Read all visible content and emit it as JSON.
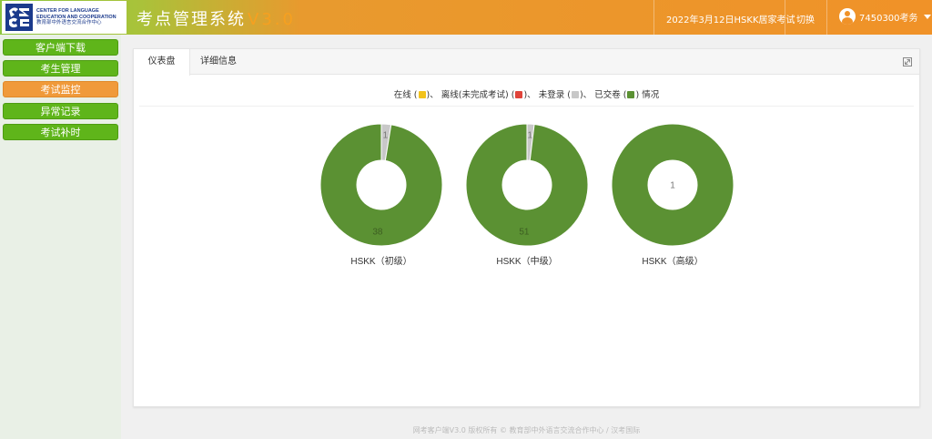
{
  "header": {
    "logo_en_line1": "CENTER FOR LANGUAGE",
    "logo_en_line2": "EDUCATION AND COOPERATION",
    "logo_cn": "教育部中外语言交流合作中心",
    "app_title": "考点管理系统",
    "version": "V3.0",
    "exam_name": "2022年3月12日HSKK居家考试",
    "switch_label": "切换",
    "user_label": "7450300考务"
  },
  "sidebar": {
    "items": [
      {
        "label": "客户端下载",
        "active": false
      },
      {
        "label": "考生管理",
        "active": false
      },
      {
        "label": "考试监控",
        "active": true
      },
      {
        "label": "异常记录",
        "active": false
      },
      {
        "label": "考试补时",
        "active": false
      }
    ]
  },
  "tabs": [
    {
      "label": "仪表盘",
      "active": true
    },
    {
      "label": "详细信息",
      "active": false
    }
  ],
  "legend": {
    "online": "在线",
    "offline": "离线(未完成考试)",
    "not_logged_in": "未登录",
    "submitted": "已交卷",
    "suffix": "情况",
    "sep": "、",
    "colors": {
      "online": "#f2c21b",
      "offline": "#e0443a",
      "not_logged_in": "#c8c8c8",
      "submitted": "#5b9133"
    }
  },
  "chart_data": [
    {
      "type": "pie",
      "title": "HSKK（初级）",
      "slices": [
        {
          "status": "not_logged_in",
          "value": 1,
          "label": "1"
        },
        {
          "status": "submitted",
          "value": 38,
          "label": "38"
        }
      ]
    },
    {
      "type": "pie",
      "title": "HSKK（中级）",
      "slices": [
        {
          "status": "not_logged_in",
          "value": 1,
          "label": "1"
        },
        {
          "status": "submitted",
          "value": 51,
          "label": "51"
        }
      ]
    },
    {
      "type": "pie",
      "title": "HSKK（高级）",
      "slices": [
        {
          "status": "submitted",
          "value": 1,
          "label": "1"
        }
      ]
    }
  ],
  "footer": {
    "text": "网考客户端V3.0 版权所有 © 教育部中外语言交流合作中心 / 汉考国际"
  },
  "icons": {
    "logo": "cle-logo-icon",
    "avatar": "user-avatar-icon",
    "caret": "chevron-down-icon",
    "expand": "expand-icon"
  }
}
